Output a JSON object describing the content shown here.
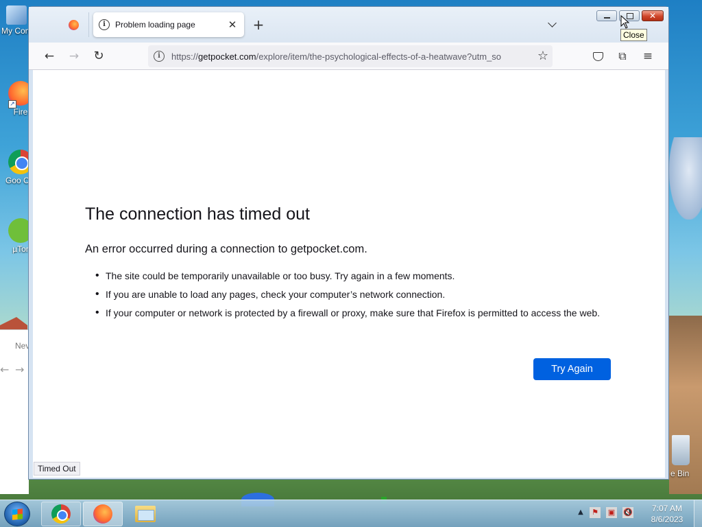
{
  "desktop": {
    "icons": [
      {
        "label": "My Com"
      },
      {
        "label": "Fire"
      },
      {
        "label": "Goo Chro"
      },
      {
        "label": "µTor"
      }
    ],
    "recycle_bin_label": "e Bin",
    "bg_window": {
      "title": "Nev",
      "back": "←",
      "forward": "→"
    }
  },
  "browser": {
    "tab": {
      "title": "Problem loading page",
      "close": "✕"
    },
    "new_tab": "+",
    "window_controls": {
      "close_glyph": "✕"
    },
    "tooltip": "Close",
    "nav": {
      "back": "←",
      "forward": "→",
      "reload": "↻"
    },
    "url": {
      "prefix": "https://",
      "host": "getpocket.com",
      "path": "/explore/item/the-psychological-effects-of-a-heatwave?utm_so"
    },
    "toolbar": {
      "bookmark": "☆",
      "extensions": "⧉",
      "menu": "≡"
    },
    "error": {
      "title": "The connection has timed out",
      "description": "An error occurred during a connection to getpocket.com.",
      "items": [
        "The site could be temporarily unavailable or too busy. Try again in a few moments.",
        "If you are unable to load any pages, check your computer’s network connection.",
        "If your computer or network is protected by a firewall or proxy, make sure that Firefox is permitted to access the web."
      ],
      "button": "Try Again"
    },
    "status": "Timed Out"
  },
  "taskbar": {
    "tray": {
      "up_arrow": "▲",
      "flag": "⚑",
      "network": "▣",
      "volume": "🔇"
    },
    "clock": {
      "time": "7:07 AM",
      "date": "8/6/2023"
    }
  },
  "colors": {
    "accent": "#0061e0",
    "close_button": "#d0462a"
  }
}
